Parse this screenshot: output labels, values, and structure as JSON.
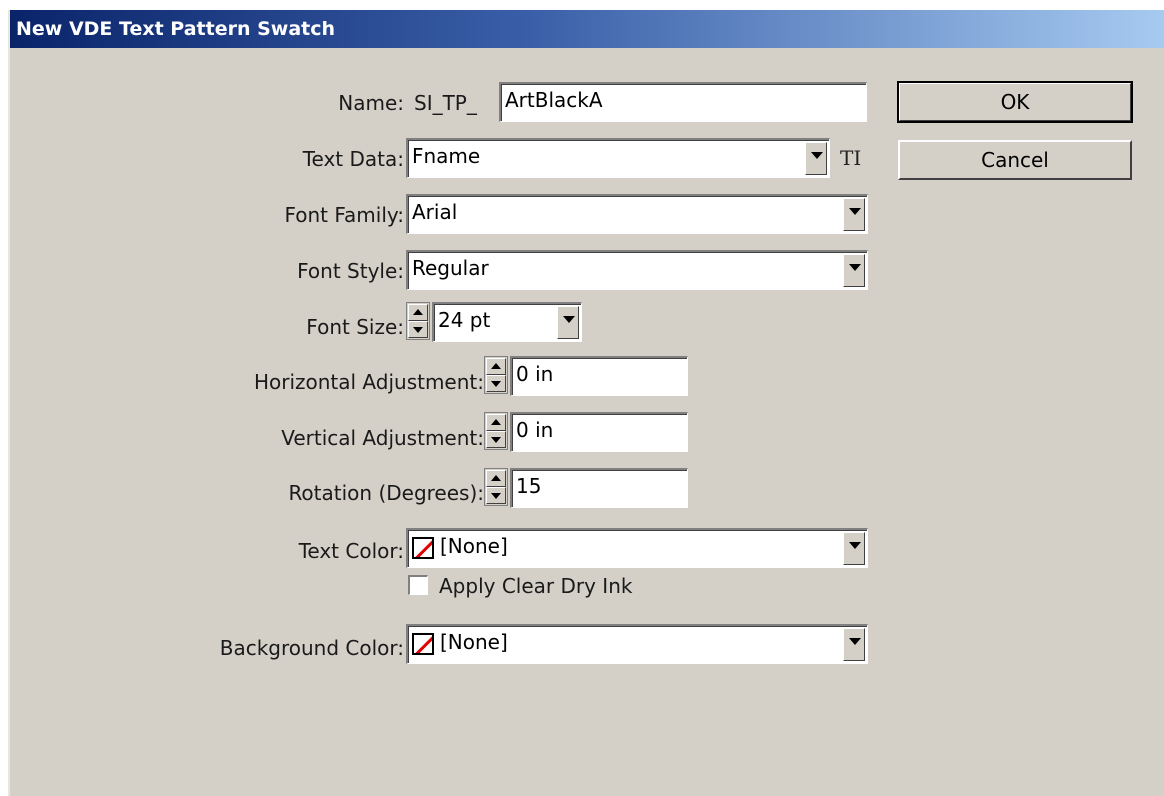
{
  "window": {
    "title": "New VDE Text Pattern Swatch"
  },
  "fields": {
    "name": {
      "label": "Name:",
      "prefix": "SI_TP_",
      "value": "ArtBlackA"
    },
    "text_data": {
      "label": "Text Data:",
      "value": "Fname",
      "icon": "text-variable-icon",
      "icon_glyph": "TI"
    },
    "font_family": {
      "label": "Font Family:",
      "value": "Arial"
    },
    "font_style": {
      "label": "Font Style:",
      "value": "Regular"
    },
    "font_size": {
      "label": "Font Size:",
      "value": "24 pt"
    },
    "horizontal_adjustment": {
      "label": "Horizontal Adjustment:",
      "value": "0 in"
    },
    "vertical_adjustment": {
      "label": "Vertical Adjustment:",
      "value": "0 in"
    },
    "rotation": {
      "label": "Rotation (Degrees):",
      "value": "15"
    },
    "text_color": {
      "label": "Text Color:",
      "value": "[None]",
      "swatch_icon": "none-swatch-icon"
    },
    "apply_clear_dry_ink": {
      "label": "Apply Clear Dry Ink",
      "checked": false
    },
    "background_color": {
      "label": "Background Color:",
      "value": "[None]",
      "swatch_icon": "none-swatch-icon"
    }
  },
  "buttons": {
    "ok": "OK",
    "cancel": "Cancel"
  },
  "colors": {
    "title_start": "#0a246a",
    "title_end": "#a6caf0",
    "dialog_bg": "#d4d0c8",
    "none_slash": "#e00000"
  }
}
